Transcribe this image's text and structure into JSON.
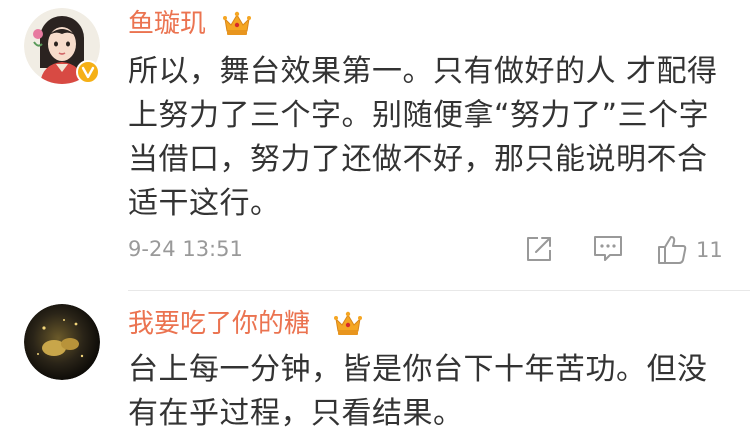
{
  "comments": [
    {
      "username": "鱼璇玑",
      "lines": [
        "所以，舞台效果第一。只有做好的人 才配得",
        "上努力了三个字。别随便拿“努力了”三个字",
        "当借口，努力了还做不好，那只能说明不合",
        "适干这行。"
      ],
      "timestamp": "9-24 13:51",
      "like_count": "11",
      "badge_icon": "crown-icon",
      "verified_icon": "verified-v-icon"
    },
    {
      "username": "我要吃了你的糖",
      "lines": [
        "台上每一分钟，皆是你台下十年苦功。但没",
        "有在乎过程，只看结果。"
      ],
      "badge_icon": "crown-icon"
    }
  ],
  "colors": {
    "username": "#eb7350",
    "text": "#333333",
    "meta": "#999999",
    "crown": "#f5a623"
  }
}
